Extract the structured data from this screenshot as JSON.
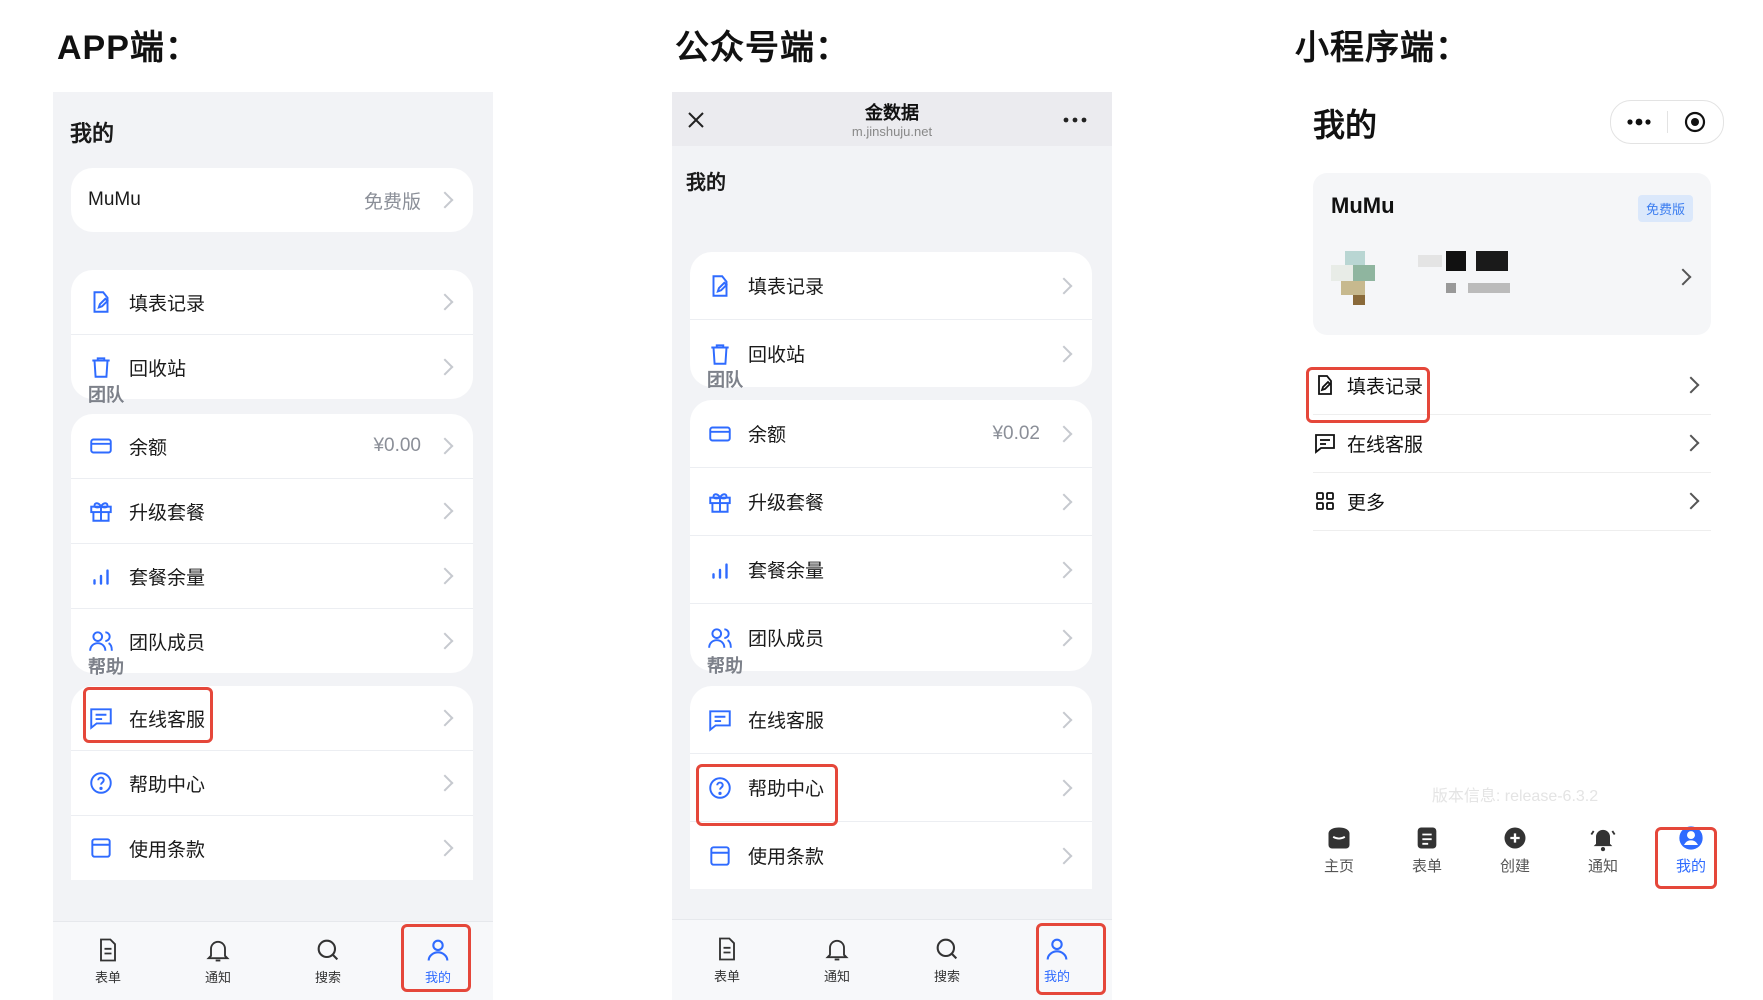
{
  "headings": {
    "app": "APP端：",
    "mp": "公众号端：",
    "mini": "小程序端："
  },
  "colors": {
    "accent": "#2f6bff",
    "highlight": "#e5473a",
    "page_bg": "#f2f3f6"
  },
  "app": {
    "page_title": "我的",
    "user": {
      "name": "MuMu",
      "plan": "免费版"
    },
    "group1": [
      {
        "label": "填表记录",
        "icon": "form-edit-icon"
      },
      {
        "label": "回收站",
        "icon": "trash-icon"
      }
    ],
    "team_title": "团队",
    "team": [
      {
        "label": "余额",
        "value": "¥0.00",
        "icon": "card-icon"
      },
      {
        "label": "升级套餐",
        "icon": "gift-icon"
      },
      {
        "label": "套餐余量",
        "icon": "bar-chart-icon"
      },
      {
        "label": "团队成员",
        "icon": "users-icon"
      }
    ],
    "help_title": "帮助",
    "help": [
      {
        "label": "在线客服",
        "icon": "chat-icon"
      },
      {
        "label": "帮助中心",
        "icon": "question-icon"
      },
      {
        "label": "使用条款",
        "icon": "terms-icon"
      }
    ],
    "tabs": [
      {
        "label": "表单",
        "icon": "form-icon"
      },
      {
        "label": "通知",
        "icon": "bell-icon"
      },
      {
        "label": "搜索",
        "icon": "search-icon"
      },
      {
        "label": "我的",
        "icon": "user-icon"
      }
    ]
  },
  "mp": {
    "nav_title": "金数据",
    "nav_url": "m.jinshuju.net",
    "page_title": "我的",
    "group1": [
      {
        "label": "填表记录"
      },
      {
        "label": "回收站"
      }
    ],
    "team_title": "团队",
    "team": [
      {
        "label": "余额",
        "value": "¥0.02"
      },
      {
        "label": "升级套餐"
      },
      {
        "label": "套餐余量"
      },
      {
        "label": "团队成员"
      }
    ],
    "help_title": "帮助",
    "help": [
      {
        "label": "在线客服"
      },
      {
        "label": "帮助中心"
      },
      {
        "label": "使用条款"
      }
    ],
    "tabs": [
      {
        "label": "表单"
      },
      {
        "label": "通知"
      },
      {
        "label": "搜索"
      },
      {
        "label": "我的"
      }
    ]
  },
  "mini": {
    "title": "我的",
    "user": {
      "name": "MuMu",
      "plan": "免费版"
    },
    "rows": [
      {
        "label": "填表记录",
        "icon": "form-edit-icon"
      },
      {
        "label": "在线客服",
        "icon": "chat-icon"
      },
      {
        "label": "更多",
        "icon": "grid-icon"
      }
    ],
    "version": "版本信息: release-6.3.2",
    "tabs": [
      {
        "label": "主页",
        "icon": "home-icon"
      },
      {
        "label": "表单",
        "icon": "form-icon"
      },
      {
        "label": "创建",
        "icon": "plus-circle-icon"
      },
      {
        "label": "通知",
        "icon": "bell-icon"
      },
      {
        "label": "我的",
        "icon": "user-icon"
      }
    ]
  }
}
